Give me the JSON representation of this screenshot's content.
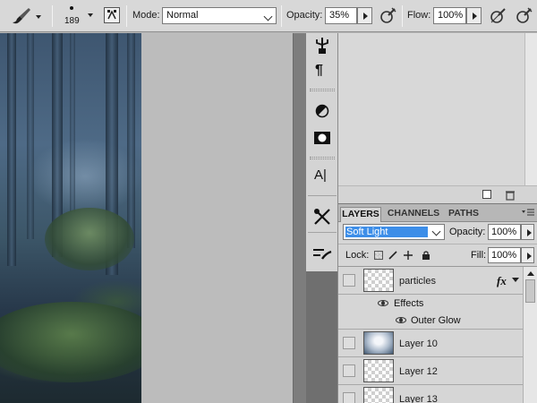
{
  "options_bar": {
    "brush_size": "189",
    "mode_label": "Mode:",
    "mode_value": "Normal",
    "opacity_label": "Opacity:",
    "opacity_value": "35%",
    "flow_label": "Flow:",
    "flow_value": "100%"
  },
  "tools_dock": {
    "paragraph_glyph": "¶",
    "character_glyph": "A|"
  },
  "layers_panel": {
    "tabs": [
      {
        "label": "LAYERS",
        "active": true
      },
      {
        "label": "CHANNELS",
        "active": false
      },
      {
        "label": "PATHS",
        "active": false
      }
    ],
    "blend_mode": "Soft Light",
    "opacity_label": "Opacity:",
    "opacity_value": "100%",
    "lock_label": "Lock:",
    "fill_label": "Fill:",
    "fill_value": "100%",
    "fx_badge": "fx",
    "layers": [
      {
        "name": "particles",
        "effects_label": "Effects",
        "effect": "Outer Glow"
      },
      {
        "name": "Layer 10"
      },
      {
        "name": "Layer 12"
      },
      {
        "name": "Layer 13"
      }
    ]
  },
  "colors": {
    "selection_highlight": "#3d8ee8",
    "panel_bg": "#d6d6d6",
    "workspace_gray": "#bcbcbc"
  }
}
